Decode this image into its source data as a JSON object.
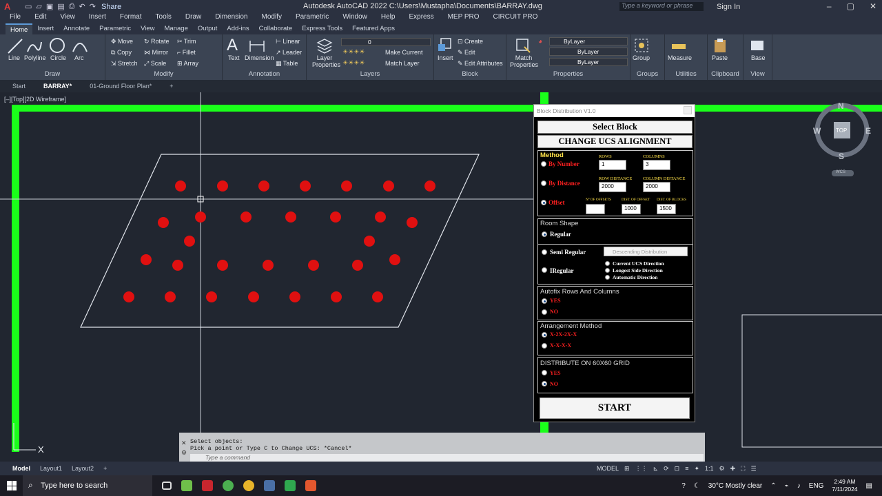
{
  "titlebar": {
    "share": "Share",
    "title": "Autodesk AutoCAD 2022   C:\\Users\\Mustapha\\Documents\\BARRAY.dwg",
    "search_placeholder": "Type a keyword or phrase",
    "signin": "Sign In"
  },
  "menu": [
    "File",
    "Edit",
    "View",
    "Insert",
    "Format",
    "Tools",
    "Draw",
    "Dimension",
    "Modify",
    "Parametric",
    "Window",
    "Help",
    "Express",
    "MEP PRO",
    "CIRCUIT PRO"
  ],
  "ribbon_tabs": [
    "Home",
    "Insert",
    "Annotate",
    "Parametric",
    "View",
    "Manage",
    "Output",
    "Add-ins",
    "Collaborate",
    "Express Tools",
    "Featured Apps"
  ],
  "ribbon": {
    "draw": {
      "title": "Draw",
      "line": "Line",
      "polyline": "Polyline",
      "circle": "Circle",
      "arc": "Arc"
    },
    "modify": {
      "title": "Modify",
      "move": "Move",
      "rotate": "Rotate",
      "trim": "Trim",
      "copy": "Copy",
      "mirror": "Mirror",
      "fillet": "Fillet",
      "stretch": "Stretch",
      "scale": "Scale",
      "array": "Array"
    },
    "annotation": {
      "title": "Annotation",
      "text": "Text",
      "dimension": "Dimension",
      "linear": "Linear",
      "leader": "Leader",
      "table": "Table"
    },
    "layers": {
      "title": "Layers",
      "layer_properties": "Layer Properties",
      "layer_value": "0",
      "make_current": "Make Current",
      "match_layer": "Match Layer"
    },
    "block": {
      "title": "Block",
      "insert": "Insert",
      "create": "Create",
      "edit": "Edit",
      "edit_attributes": "Edit Attributes"
    },
    "properties": {
      "title": "Properties",
      "match_properties": "Match Properties",
      "color": "ByLayer",
      "linetype": "ByLayer",
      "lineweight": "ByLayer"
    },
    "groups": {
      "title": "Groups",
      "group": "Group"
    },
    "utilities": {
      "title": "Utilities",
      "measure": "Measure"
    },
    "clipboard": {
      "title": "Clipboard",
      "paste": "Paste"
    },
    "view": {
      "title": "View",
      "base": "Base"
    }
  },
  "doc_tabs": [
    "Start",
    "BARRAY*",
    "01-Ground Floor Plan*"
  ],
  "view_label": "[–][Top][2D Wireframe]",
  "viewcube": {
    "n": "N",
    "s": "S",
    "e": "E",
    "w": "W",
    "top": "TOP",
    "wcs": "WCS"
  },
  "dialog": {
    "title": "Block Distribution V1.0",
    "select_block": "Select Block",
    "change_ucs": "CHANGE UCS ALIGNMENT",
    "method": {
      "title": "Method",
      "by_number": "By Number",
      "by_distance": "By Distance",
      "offset": "Offset",
      "rows_label": "ROWS",
      "columns_label": "COLUMNS",
      "rows_value": "1",
      "columns_value": "3",
      "row_distance_label": "ROW DISTANCE",
      "column_distance_label": "COLUMN DISTANCE",
      "row_distance_value": "2000",
      "column_distance_value": "2000",
      "num_offsets_label": "Nº OF OFFSETS",
      "dist_offset_label": "DIST. OF OFFSET",
      "dist_blocks_label": "DIST. OF BLOCKS",
      "num_offsets_value": "",
      "dist_offset_value": "1000",
      "dist_blocks_value": "1500"
    },
    "room_shape": {
      "title": "Room Shape",
      "regular": "Regular",
      "semi_regular": "Semi Regular",
      "descending": "Descending Distribution",
      "irregular": "IRegular",
      "current_ucs": "Current UCS Direction",
      "longest_side": "Longest Side Direction",
      "automatic": "Automatic Direction"
    },
    "autofix": {
      "title": "Autofix Rows And Columns",
      "yes": "YES",
      "no": "NO"
    },
    "arrangement": {
      "title": "Arrangement Method",
      "opt1": "X-2X-2X-X",
      "opt2": "X-X-X-X"
    },
    "grid": {
      "title": "DISTRIBUTE ON 60X60 GRID",
      "yes": "YES",
      "no": "NO"
    },
    "start": "START"
  },
  "command": {
    "line1": "Select objects:",
    "line2": "Pick a point or Type C to Change UCS: *Cancel*",
    "placeholder": "Type a command"
  },
  "layout_tabs": [
    "Model",
    "Layout1",
    "Layout2"
  ],
  "status": {
    "model": "MODEL",
    "scale": "1:1"
  },
  "taskbar": {
    "search": "Type here to search",
    "weather": "30°C  Mostly clear",
    "lang": "ENG",
    "time": "2:49 AM",
    "date": "7/11/2024"
  },
  "colors": {
    "accent_green": "#1aff1a",
    "dot_red": "#e01010",
    "dialog_yellow": "#ffe24a"
  }
}
